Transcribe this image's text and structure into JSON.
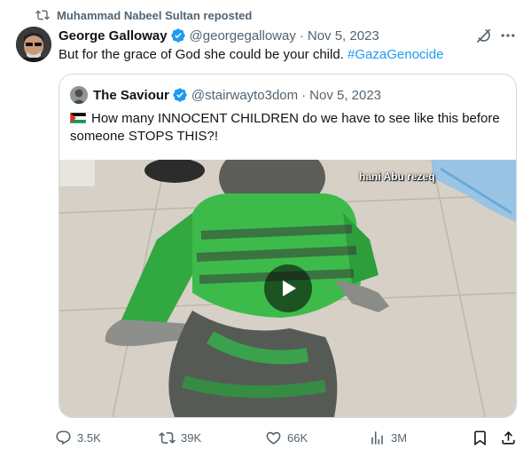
{
  "repost": {
    "text": "Muhammad Nabeel Sultan reposted"
  },
  "tweet": {
    "author_name": "George Galloway",
    "handle": "@georgegalloway",
    "separator": "·",
    "date": "Nov 5, 2023",
    "text": "But for the grace of God she could be your child.",
    "hashtag": "#GazaGenocide"
  },
  "quote": {
    "author_name": "The Saviour",
    "handle": "@stairwayto3dom",
    "separator": "·",
    "date": "Nov 5, 2023",
    "text": "How many INNOCENT CHILDREN do we have to see like this before someone STOPS THIS?!",
    "media_watermark": "hani Abu rezeq"
  },
  "actions": {
    "replies": "3.5K",
    "reposts": "39K",
    "likes": "66K",
    "views": "3M"
  },
  "colors": {
    "accent": "#1d9bf0",
    "muted": "#536471",
    "border": "#cfd9de",
    "text": "#0f1419"
  },
  "icons": [
    "repost-icon",
    "verified-badge-icon",
    "grok-icon",
    "more-icon",
    "palestine-flag-icon",
    "play-icon",
    "reply-icon",
    "like-icon",
    "views-icon",
    "bookmark-icon",
    "share-icon"
  ]
}
